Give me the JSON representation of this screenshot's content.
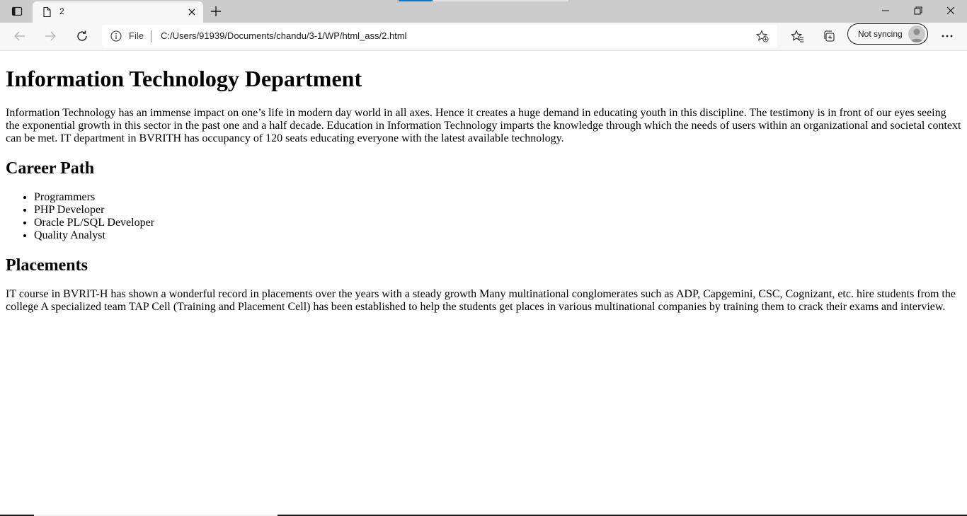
{
  "tab": {
    "title": "2"
  },
  "toolbar": {
    "file_label": "File",
    "url": "C:/Users/91939/Documents/chandu/3-1/WP/html_ass/2.html",
    "sync_label": "Not syncing"
  },
  "page": {
    "heading": "Information Technology Department",
    "intro": "Information Technology has an immense impact on one’s life in modern day world in all axes. Hence it creates a huge demand in educating youth in this discipline. The testimony is in front of our eyes seeing the exponential growth in this sector in the past one and a half decade. Education in Information Technology imparts the knowledge through which the needs of users within an organizational and societal context can be met. IT department in BVRITH has occupancy of 120 seats educating everyone with the latest available technology.",
    "career_heading": "Career Path",
    "career_items": [
      "Programmers",
      "PHP Developer",
      "Oracle PL/SQL Developer",
      "Quality Analyst"
    ],
    "placements_heading": "Placements",
    "placements_text": "IT course in BVRIT-H has shown a wonderful record in placements over the years with a steady growth Many multinational conglomerates such as ADP, Capgemini, CSC, Cognizant, etc. hire students from the college A specialized team TAP Cell (Training and Placement Cell) has been established to help the students get places in various multinational companies by training them to crack their exams and interview."
  }
}
